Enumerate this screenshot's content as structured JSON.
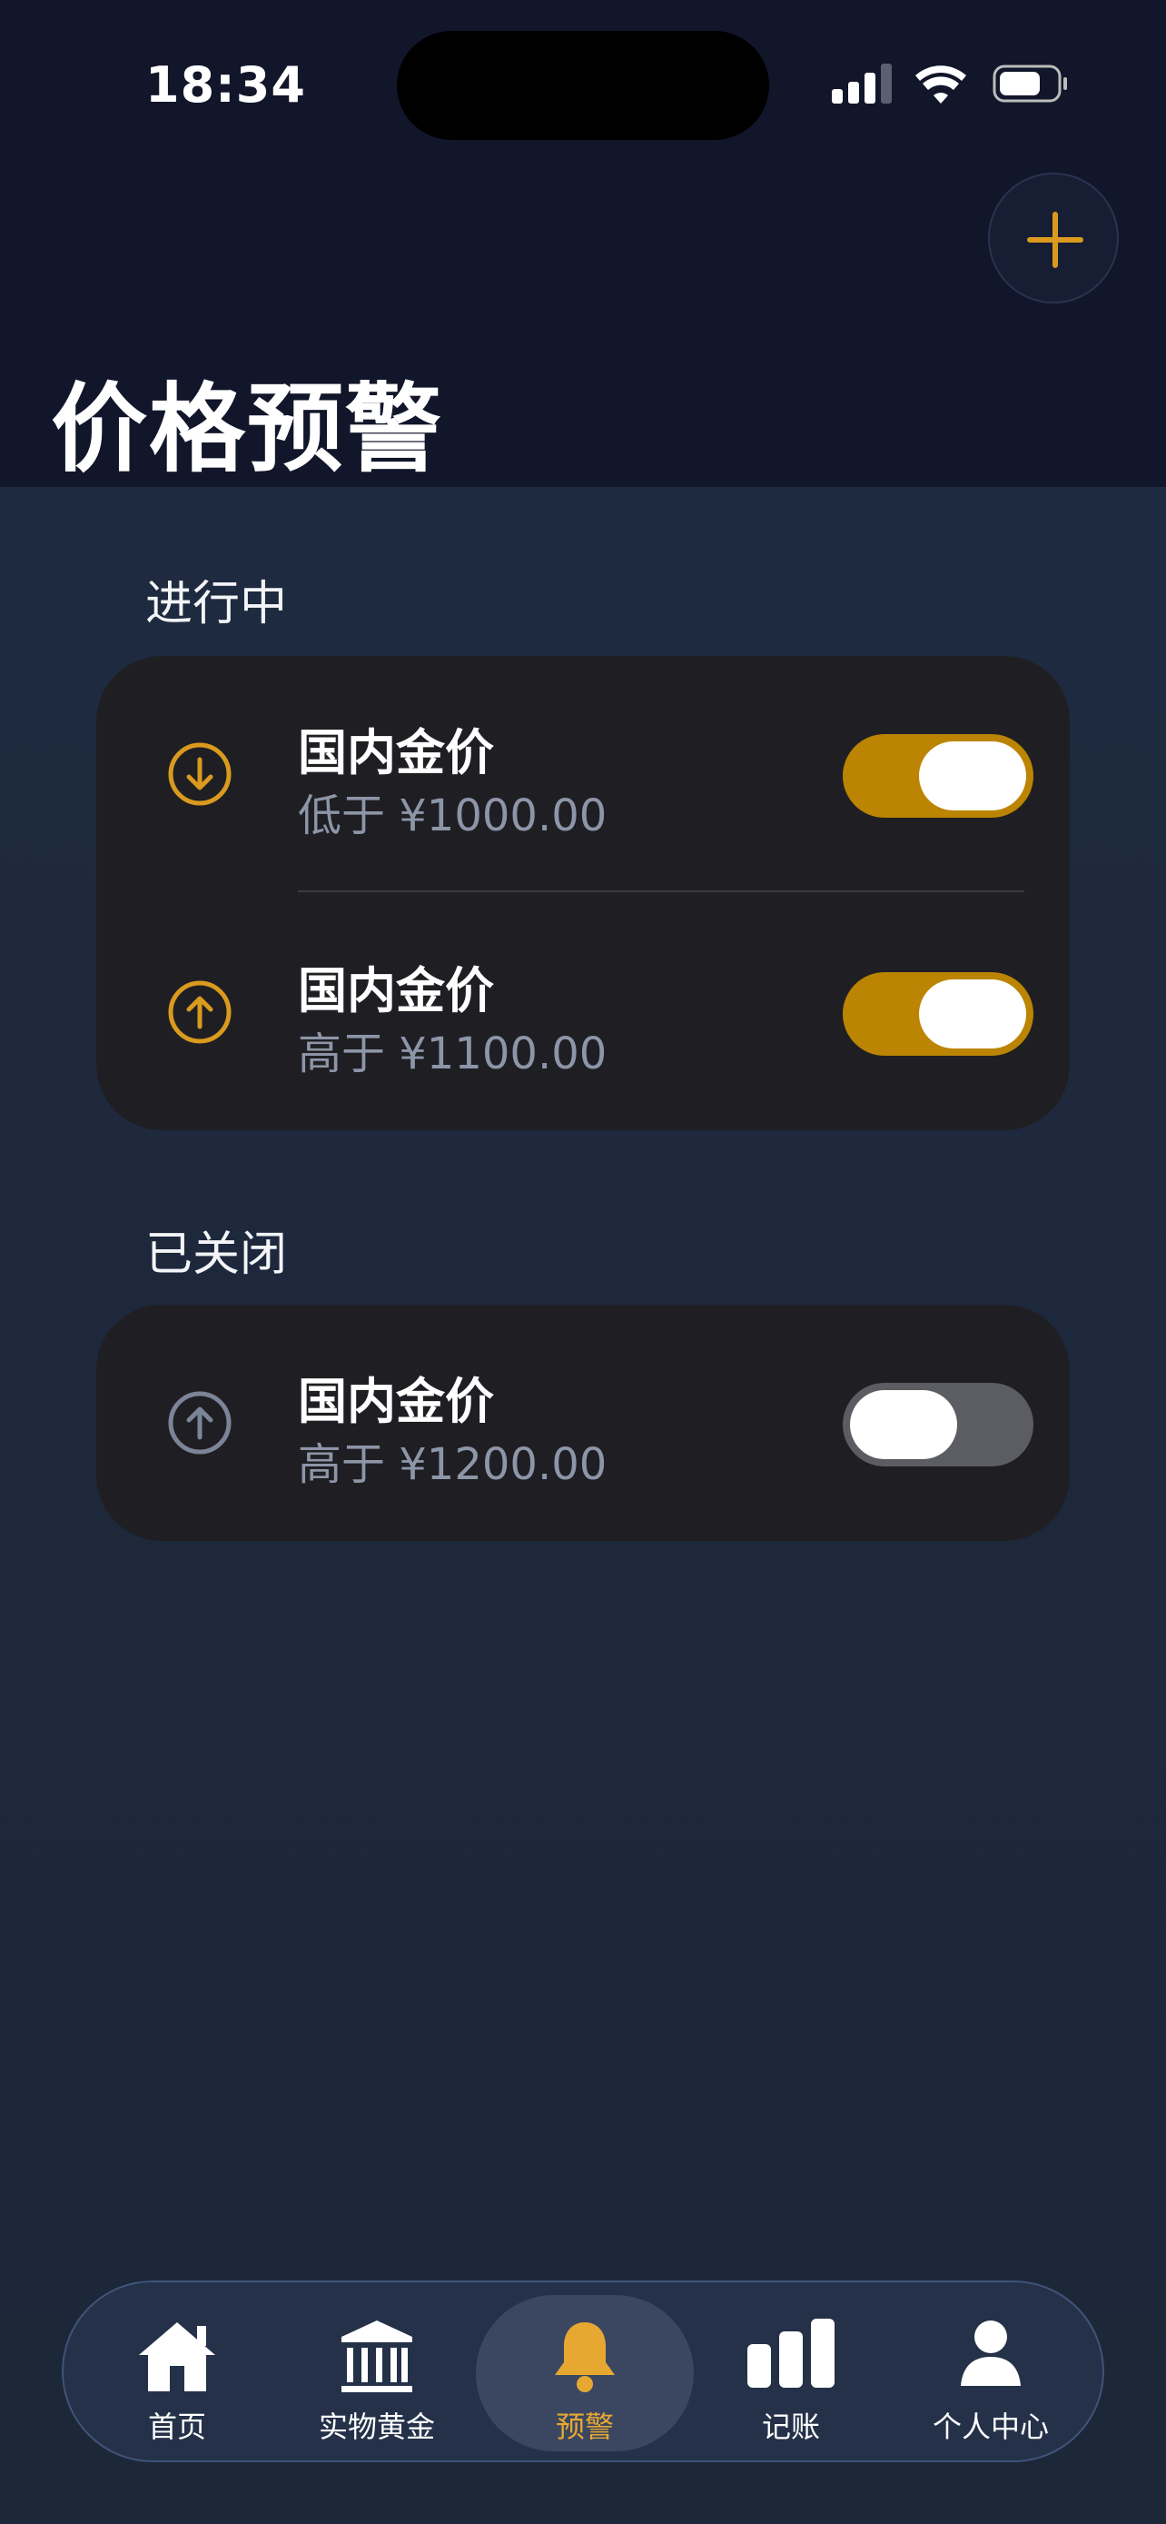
{
  "status": {
    "time": "18:34"
  },
  "page": {
    "title": "价格预警"
  },
  "sections": {
    "active": {
      "label": "进行中",
      "items": [
        {
          "title": "国内金价",
          "condition": "低于 ¥1000.00",
          "direction": "down",
          "enabled": true
        },
        {
          "title": "国内金价",
          "condition": "高于 ¥1100.00",
          "direction": "up",
          "enabled": true
        }
      ]
    },
    "closed": {
      "label": "已关闭",
      "items": [
        {
          "title": "国内金价",
          "condition": "高于 ¥1200.00",
          "direction": "up",
          "enabled": false
        }
      ]
    }
  },
  "tabbar": {
    "items": [
      {
        "label": "首页",
        "icon": "home-icon"
      },
      {
        "label": "实物黄金",
        "icon": "bank-icon"
      },
      {
        "label": "预警",
        "icon": "bell-icon",
        "active": true
      },
      {
        "label": "记账",
        "icon": "bar-chart-icon"
      },
      {
        "label": "个人中心",
        "icon": "person-icon"
      }
    ]
  },
  "colors": {
    "accent": "#bb8402",
    "accent_icon": "#d99a1e",
    "inactive_icon": "#8d95a8",
    "tab_active": "#e7a832"
  }
}
